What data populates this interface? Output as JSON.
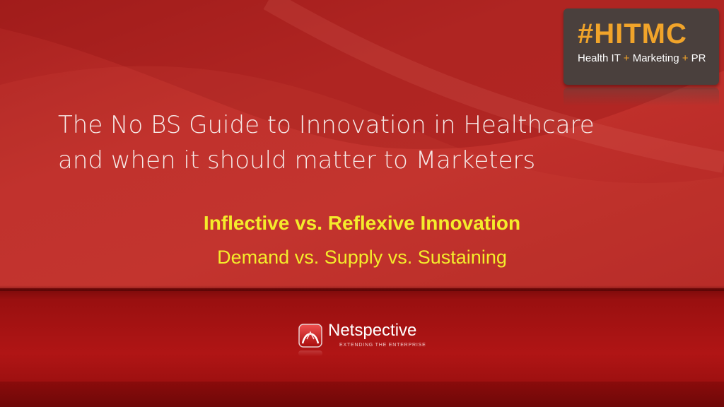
{
  "badge": {
    "title": "#HITMC",
    "subtitle_parts": [
      "Health IT",
      " + ",
      "Marketing",
      " + ",
      "PR"
    ]
  },
  "title": {
    "line1": "The No BS Guide to Innovation in Healthcare",
    "line2": "and when it should matter to Marketers"
  },
  "subtitle_bold": "Inflective vs. Reflexive Innovation",
  "subtitle": "Demand vs. Supply vs. Sustaining",
  "logo": {
    "name": "Netspective",
    "tagline": "EXTENDING THE ENTERPRISE"
  },
  "colors": {
    "background_red": "#bd2e2a",
    "bottom_band": "#b01515",
    "badge_bg": "#4a403d",
    "accent_orange": "#f1a42a",
    "subtitle_yellow": "#f4ec2b",
    "title_text": "#f6e9e7"
  }
}
